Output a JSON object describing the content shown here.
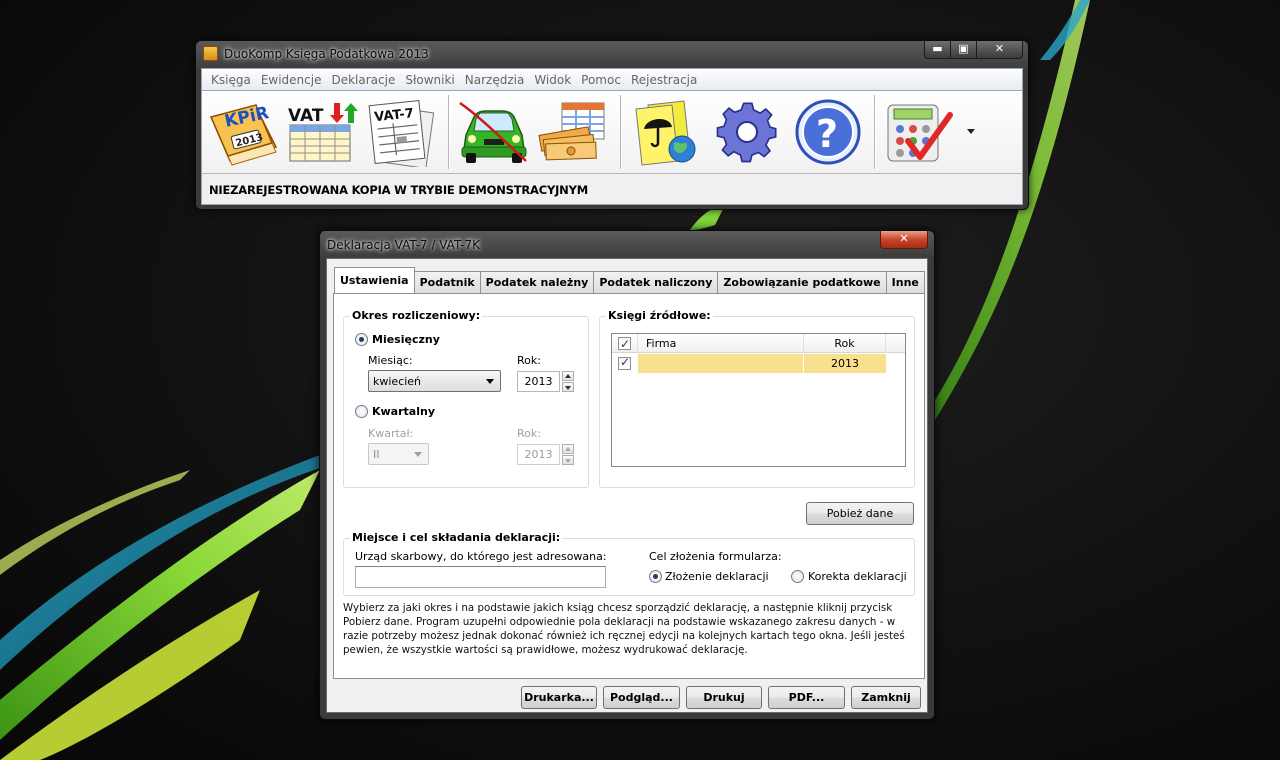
{
  "app": {
    "title": "DuoKomp Księga Podatkowa 2013",
    "menu": [
      "Księga",
      "Ewidencje",
      "Deklaracje",
      "Słowniki",
      "Narzędzia",
      "Widok",
      "Pomoc",
      "Rejestracja"
    ],
    "toolbar": {
      "kpir_text": "KPiR",
      "kpir_year": "2013",
      "vat_text": "VAT",
      "vat7_text": "VAT-7"
    },
    "status": "NIEZAREJESTROWANA KOPIA W TRYBIE DEMONSTRACYJNYM"
  },
  "dialog": {
    "title": "Deklaracja VAT-7 / VAT-7K",
    "tabs": [
      "Ustawienia",
      "Podatnik",
      "Podatek należny",
      "Podatek naliczony",
      "Zobowiązanie podatkowe",
      "Inne"
    ],
    "okres": {
      "label": "Okres rozliczeniowy:",
      "monthly_label": "Miesięczny",
      "month_label": "Miesiąc:",
      "month_value": "kwiecień",
      "year_label": "Rok:",
      "year_value": "2013",
      "quarterly_label": "Kwartalny",
      "quarter_label": "Kwartał:",
      "quarter_value": "II",
      "q_year_label": "Rok:",
      "q_year_value": "2013"
    },
    "ksiegi": {
      "label": "Księgi źródłowe:",
      "col_firma": "Firma",
      "col_rok": "Rok",
      "rows": [
        {
          "firma": "",
          "rok": "2013"
        }
      ]
    },
    "fetch_button": "Pobież dane",
    "miejsce": {
      "label": "Miejsce i cel składania deklaracji:",
      "office_label": "Urząd skarbowy, do którego jest adresowana:",
      "office_value": "",
      "purpose_label": "Cel złożenia formularza:",
      "opt_submit": "Złożenie deklaracji",
      "opt_correction": "Korekta deklaracji"
    },
    "info": "Wybierz za jaki okres i na podstawie jakich ksiąg chcesz sporządzić deklarację, a następnie kliknij przycisk Pobierz dane. Program uzupełni odpowiednie pola deklaracji na podstawie wskazanego zakresu danych - w razie potrzeby możesz jednak dokonać również ich ręcznej edycji na kolejnych kartach tego okna. Jeśli jesteś pewien, że wszystkie wartości są prawidłowe, możesz wydrukować deklarację.",
    "buttons": {
      "printer": "Drukarka...",
      "preview": "Podgląd...",
      "print": "Drukuj",
      "pdf": "PDF...",
      "close": "Zamknij"
    }
  },
  "colors": {
    "accent_green": "#5ec21f",
    "selected_row": "#f8e08e",
    "tab_border": "#8e8f8f"
  }
}
